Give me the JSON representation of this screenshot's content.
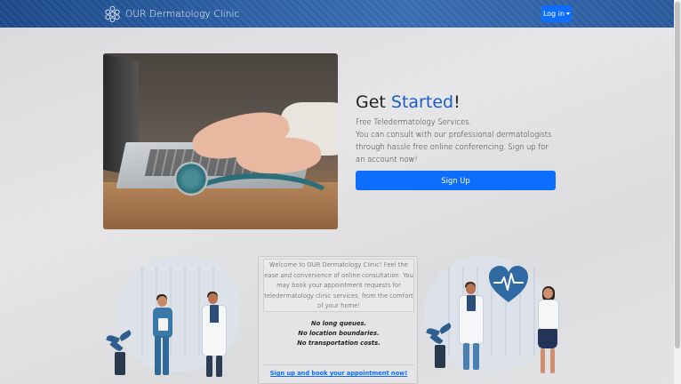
{
  "navbar": {
    "brand": "OUR Dermatology Clinic",
    "login_label": "Log in"
  },
  "hero": {
    "title_plain": "Get ",
    "title_accent": "Started",
    "title_end": "!",
    "description_line1": "Free Teledermatology Services.",
    "description_line2": "You can consult with our professional dermatologists through hassle free online conferencing. Sign up for an account now!",
    "signup_label": "Sign Up"
  },
  "info": {
    "welcome": "Welcome to OUR Dermatology Clinic! Feel the ease and convenience of online consultation. You may book your appointment requests for teledermatology clinic services, from the comfort of your home!",
    "perk1": "No long queues.",
    "perk2": "No location boundaries.",
    "perk3": "No transportation costs.",
    "book_link": "Sign up and book your appointment now!"
  },
  "colors": {
    "primary": "#0d6efd",
    "accent_text": "#1a5cc8",
    "navbar": "#2a5ea3"
  }
}
